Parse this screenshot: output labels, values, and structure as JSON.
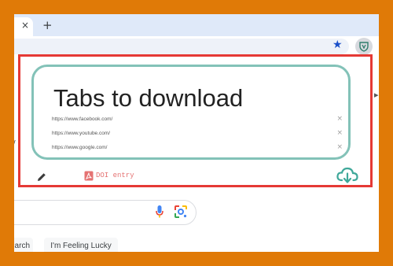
{
  "browser": {
    "tab_close_glyph": "×",
    "new_tab_glyph": "+",
    "bookmark_star_glyph": "★"
  },
  "google": {
    "search_button_label": "arch",
    "lucky_button_label": "I'm Feeling Lucky"
  },
  "popup": {
    "title": "Tabs to download",
    "tabs": [
      {
        "url": "https://www.facebook.com/"
      },
      {
        "url": "https://www.youtube.com/"
      },
      {
        "url": "https://www.google.com/"
      }
    ],
    "remove_glyph": "×",
    "doi_label": "DOI entry"
  },
  "colors": {
    "frame_orange": "#e07a07",
    "highlight_red": "#e53935",
    "card_teal": "#83c2b8",
    "download_teal": "#3fa89a",
    "pdf_red": "#e57373"
  }
}
